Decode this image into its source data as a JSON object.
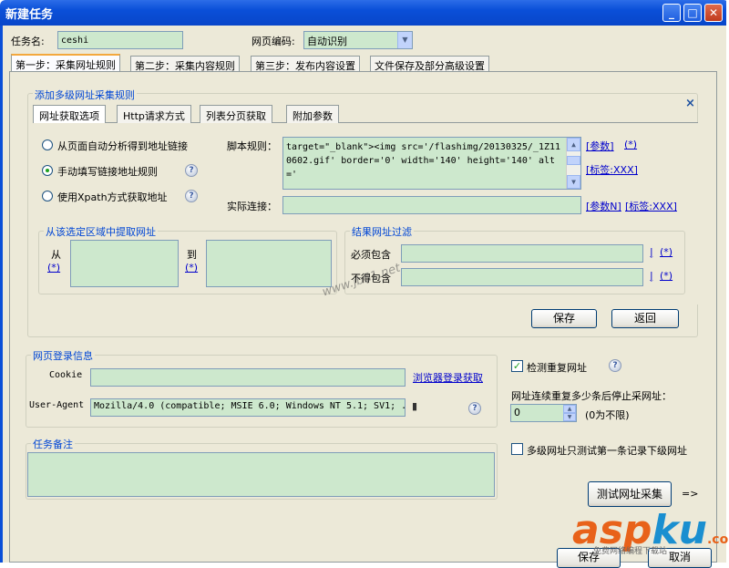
{
  "window": {
    "title": "新建任务",
    "min": "_",
    "max": "□",
    "close": "✕"
  },
  "task": {
    "name_label": "任务名:",
    "name_value": "ceshi",
    "encoding_label": "网页编码:",
    "encoding_value": "自动识别"
  },
  "main_tabs": [
    "第一步：采集网址规则",
    "第二步：采集内容规则",
    "第三步：发布内容设置",
    "文件保存及部分高级设置"
  ],
  "rule_group": {
    "title": "添加多级网址采集规则",
    "close": "×"
  },
  "inner_tabs": [
    "网址获取选项",
    "Http请求方式",
    "列表分页获取",
    "附加参数"
  ],
  "options": [
    {
      "label": "从页面自动分析得到地址链接",
      "selected": false
    },
    {
      "label": "手动填写链接地址规则",
      "selected": true
    },
    {
      "label": "使用Xpath方式获取地址",
      "selected": false
    }
  ],
  "script_rule": {
    "label": "脚本规则：",
    "value": "target=\"_blank\"><img src='/flashimg/20130325/_1Z110602.gif' border='0' width='140' height='140' alt='",
    "links": [
      "[参数]",
      "(*)",
      "[标签:XXX]"
    ]
  },
  "actual_link": {
    "label": "实际连接：",
    "value": "",
    "links": [
      "[参数N]",
      "[标签:XXX]"
    ]
  },
  "extract_area": {
    "title": "从该选定区域中提取网址",
    "from": "从",
    "to": "到",
    "wildcard": "(*)"
  },
  "filter": {
    "title": "结果网址过滤",
    "must_label": "必须包含",
    "mustnot_label": "不得包含",
    "pipe": "|",
    "wildcard": "(*)"
  },
  "buttons": {
    "save": "保存",
    "back": "返回",
    "test": "测试网址采集",
    "arrow": "=>",
    "bottom_save": "保存",
    "bottom_cancel": "取消"
  },
  "login": {
    "title": "网页登录信息",
    "cookie_label": "Cookie",
    "cookie_value": "",
    "browser_link": "浏览器登录获取",
    "ua_label": "User-Agent",
    "ua_value": "Mozilla/4.0 (compatible; MSIE 6.0; Windows NT 5.1; SV1; ."
  },
  "dup": {
    "label": "检测重复网址",
    "checked": true,
    "stop_label": "网址连续重复多少条后停止采网址：",
    "stop_value": "0",
    "stop_hint": "(0为不限)"
  },
  "notes": {
    "title": "任务备注",
    "value": ""
  },
  "multilevel": {
    "label": "多级网址只测试第一条记录下级网址",
    "checked": false
  },
  "watermark": {
    "site": "www.jb51.net",
    "brand_a": "asp",
    "brand_b": "ku",
    "brand_c": ".com",
    "brand_sub": "免费网络编程下载站"
  },
  "colors": {
    "title_bar": "#0a4fd8",
    "field_bg": "#cde8cd",
    "group_title": "#0046d5",
    "link": "#0000cc"
  }
}
